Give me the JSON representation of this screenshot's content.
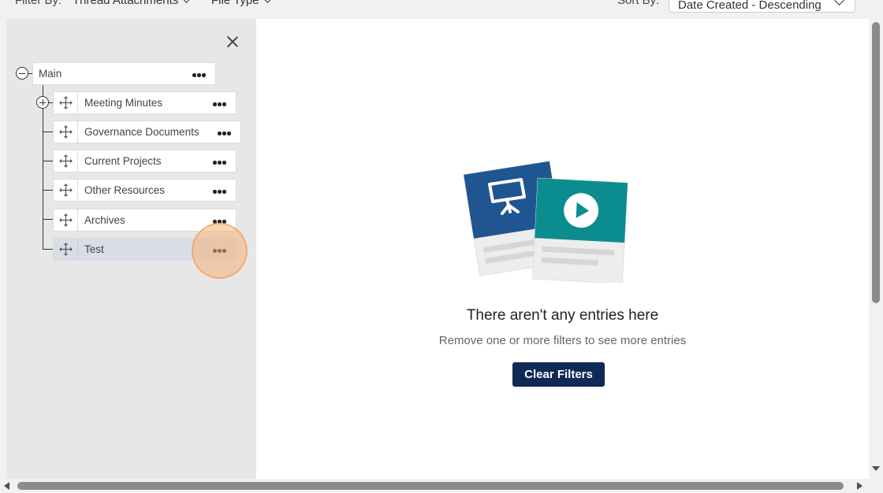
{
  "filter_bar": {
    "filter_by_label": "Filter By:",
    "thread_filter": "Thread Attachments",
    "file_type_filter": "File Type",
    "sort_by_label": "Sort By:",
    "sort_value": "Date Created - Descending"
  },
  "tree": {
    "root": {
      "label": "Main"
    },
    "children": [
      {
        "label": "Meeting Minutes",
        "has_children": true
      },
      {
        "label": "Governance Documents"
      },
      {
        "label": "Current Projects"
      },
      {
        "label": "Other Resources"
      },
      {
        "label": "Archives"
      },
      {
        "label": "Test",
        "selected": true
      }
    ]
  },
  "empty_state": {
    "title": "There aren't any entries here",
    "subtitle": "Remove one or more filters to see more entries",
    "clear_button": "Clear Filters"
  },
  "colors": {
    "brand_navy": "#0e2a55",
    "illustration_blue": "#1f5591",
    "illustration_teal": "#0b8c8f",
    "highlight": "#f6b278"
  }
}
